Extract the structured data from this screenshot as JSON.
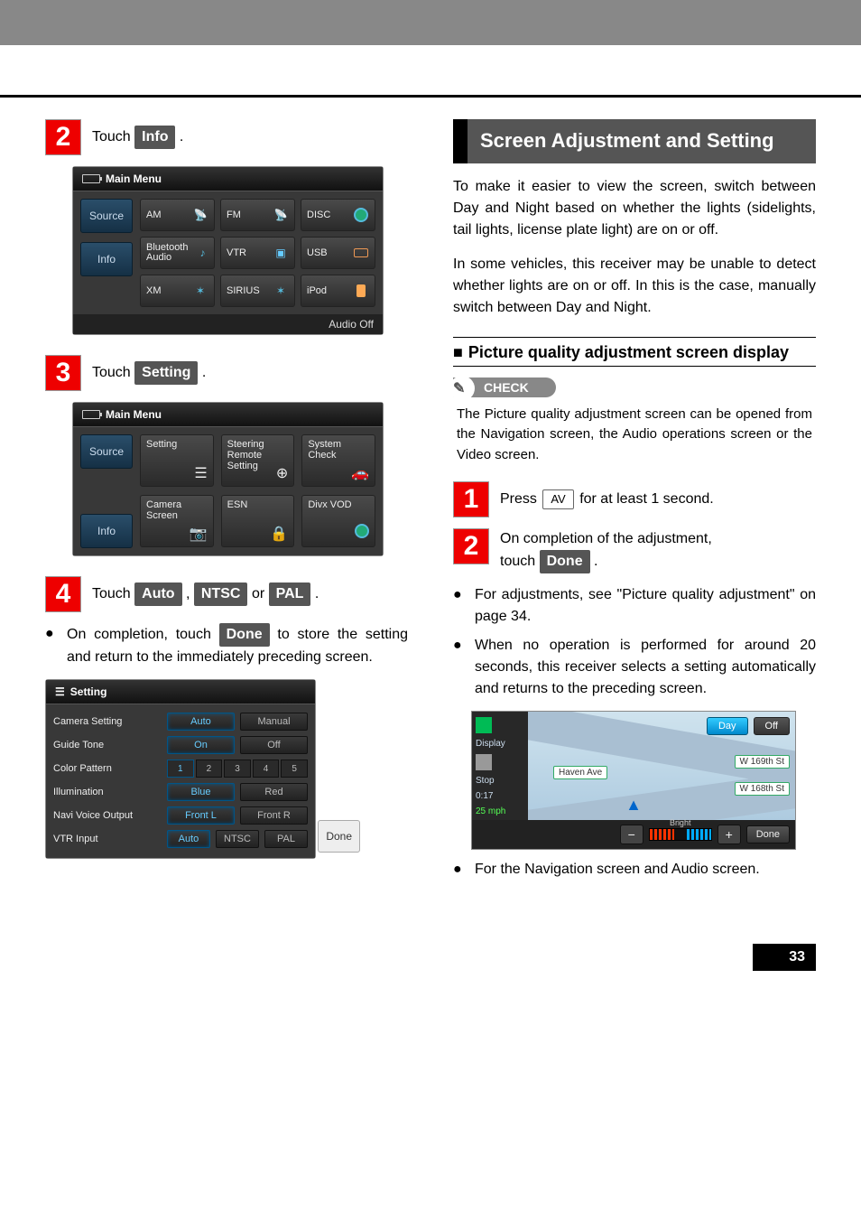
{
  "page_number": "33",
  "left": {
    "step2": {
      "prefix": "Touch ",
      "button": "Info",
      "suffix": " ."
    },
    "shot1": {
      "title": "Main Menu",
      "side": [
        "Source",
        "Info"
      ],
      "cells": [
        "AM",
        "FM",
        "DISC",
        "Bluetooth Audio",
        "VTR",
        "USB",
        "XM",
        "SIRIUS",
        "iPod"
      ],
      "footer": "Audio Off"
    },
    "step3": {
      "prefix": "Touch ",
      "button": "Setting",
      "suffix": " ."
    },
    "shot2": {
      "title": "Main Menu",
      "side": [
        "Source",
        "Info"
      ],
      "tiles": [
        "Setting",
        "Steering Remote Setting",
        "System Check",
        "Camera Screen",
        "ESN",
        "Divx VOD"
      ]
    },
    "step4": {
      "prefix": "Touch ",
      "b1": "Auto",
      "sep1": " , ",
      "b2": "NTSC",
      "sep2": " or ",
      "b3": "PAL",
      "suffix": " ."
    },
    "after4_a": "On completion, touch ",
    "after4_btn": "Done",
    "after4_b": " to store the setting and return to the immediately preceding screen.",
    "shot3": {
      "title": "Setting",
      "rows": {
        "camera": {
          "label": "Camera Setting",
          "opts": [
            "Auto",
            "Manual"
          ],
          "sel": 0
        },
        "guide": {
          "label": "Guide Tone",
          "opts": [
            "On",
            "Off"
          ],
          "sel": 0
        },
        "color": {
          "label": "Color Pattern",
          "opts": [
            "1",
            "2",
            "3",
            "4",
            "5"
          ],
          "sel": 0
        },
        "illum": {
          "label": "Illumination",
          "opts": [
            "Blue",
            "Red"
          ],
          "sel": 0
        },
        "navi": {
          "label": "Navi Voice Output",
          "opts": [
            "Front L",
            "Front R"
          ],
          "sel": 0
        },
        "vtr": {
          "label": "VTR Input",
          "opts": [
            "Auto",
            "NTSC",
            "PAL"
          ],
          "sel": 0
        }
      },
      "done": "Done"
    }
  },
  "right": {
    "heading": "Screen Adjustment and Setting",
    "p1": "To make it easier to view the screen, switch between Day and Night based on whether the lights (sidelights, tail lights, license plate light) are on or off.",
    "p2": "In some vehicles, this receiver may be unable to detect whether lights are on or off. In this is the case, manually switch between Day and Night.",
    "sub": "Picture quality adjustment screen display",
    "check_label": "CHECK",
    "check_text": "The Picture quality adjustment screen can be opened from the Navigation screen, the Audio operations screen or the Video screen.",
    "step1": {
      "prefix": "Press ",
      "button": "AV",
      "suffix": " for at least 1 second."
    },
    "step2": {
      "line1": "On completion of the adjustment,",
      "line2a": "touch ",
      "button": "Done",
      "line2b": " ."
    },
    "b1": "For adjustments, see \"Picture quality adjustment\" on page 34.",
    "b2": "When no operation is performed for around 20 seconds, this receiver selects a setting automatically and returns to the preceding screen.",
    "nav": {
      "display_label": "Display",
      "day": "Day",
      "off": "Off",
      "stop": "Stop",
      "time": "0:17",
      "speed": "25 mph",
      "s1": "W 169th St",
      "s2": "W 168th St",
      "s3": "Haven Ave",
      "bright": "Bright",
      "done": "Done"
    },
    "b3": "For the Navigation screen and Audio screen."
  }
}
